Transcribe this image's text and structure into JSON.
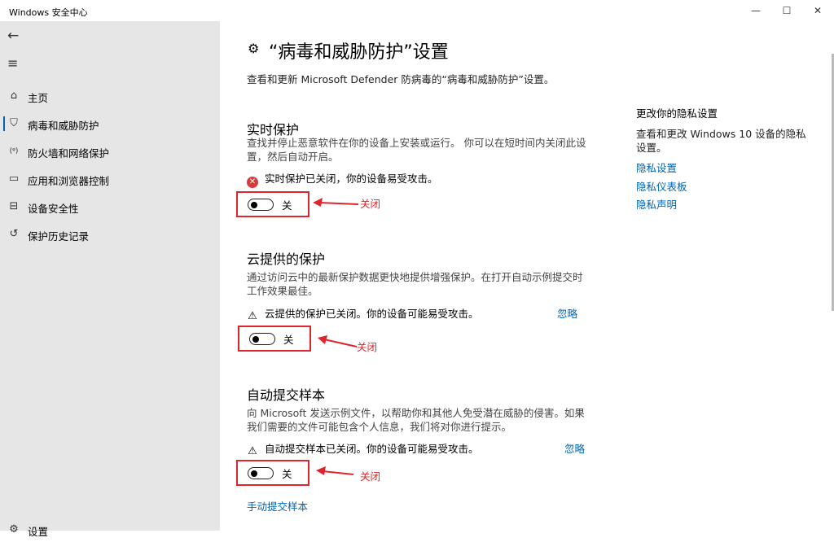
{
  "window": {
    "title": "Windows 安全中心",
    "minimize": "—",
    "maximize": "☐",
    "close": "✕"
  },
  "sidebar": {
    "back_icon": "arrow-left-icon",
    "menu_icon": "hamburger-icon",
    "items": [
      {
        "label": "主页",
        "icon": "home-icon",
        "glyph": "⌂"
      },
      {
        "label": "病毒和威胁防护",
        "icon": "shield-icon",
        "glyph": "⛉",
        "selected": true
      },
      {
        "label": "防火墙和网络保护",
        "icon": "wifi-antenna-icon",
        "glyph": "(ᵠ)"
      },
      {
        "label": "应用和浏览器控制",
        "icon": "browser-window-icon",
        "glyph": "▭"
      },
      {
        "label": "设备安全性",
        "icon": "laptop-icon",
        "glyph": "⊟"
      },
      {
        "label": "保护历史记录",
        "icon": "history-icon",
        "glyph": "↺"
      }
    ],
    "settings_label": "设置"
  },
  "main": {
    "title": "“病毒和威胁防护”设置",
    "description": "查看和更新 Microsoft Defender 防病毒的“病毒和威胁防护”设置。",
    "sections": [
      {
        "title": "实时保护",
        "description": "查找并停止恶意软件在你的设备上安装或运行。 你可以在短时间内关闭此设置，然后自动开启。",
        "status_icon": "error-circle-icon",
        "status_text": "实时保护已关闭，你的设备易受攻击。",
        "toggle_label": "关",
        "toggle_on": false,
        "annotation": "关闭"
      },
      {
        "title": "云提供的保护",
        "description": "通过访问云中的最新保护数据更快地提供增强保护。在打开自动示例提交时工作效果最佳。",
        "status_icon": "warning-icon",
        "status_text": "云提供的保护已关闭。你的设备可能易受攻击。",
        "ignore_label": "忽略",
        "toggle_label": "关",
        "toggle_on": false,
        "annotation": "关闭"
      },
      {
        "title": "自动提交样本",
        "description": "向 Microsoft 发送示例文件，以帮助你和其他人免受潜在威胁的侵害。如果我们需要的文件可能包含个人信息，我们将对你进行提示。",
        "status_icon": "warning-icon",
        "status_text": "自动提交样本已关闭。你的设备可能易受攻击。",
        "ignore_label": "忽略",
        "toggle_label": "关",
        "toggle_on": false,
        "annotation": "关闭"
      }
    ],
    "manual_submit_link": "手动提交样本"
  },
  "privacy": {
    "title": "更改你的隐私设置",
    "description": "查看和更改 Windows 10 设备的隐私设置。",
    "links": [
      "隐私设置",
      "隐私仪表板",
      "隐私声明"
    ]
  },
  "colors": {
    "accent": "#0063b1",
    "annotation_red": "#e0242b",
    "sidebar_bg": "#e6e6e6"
  }
}
